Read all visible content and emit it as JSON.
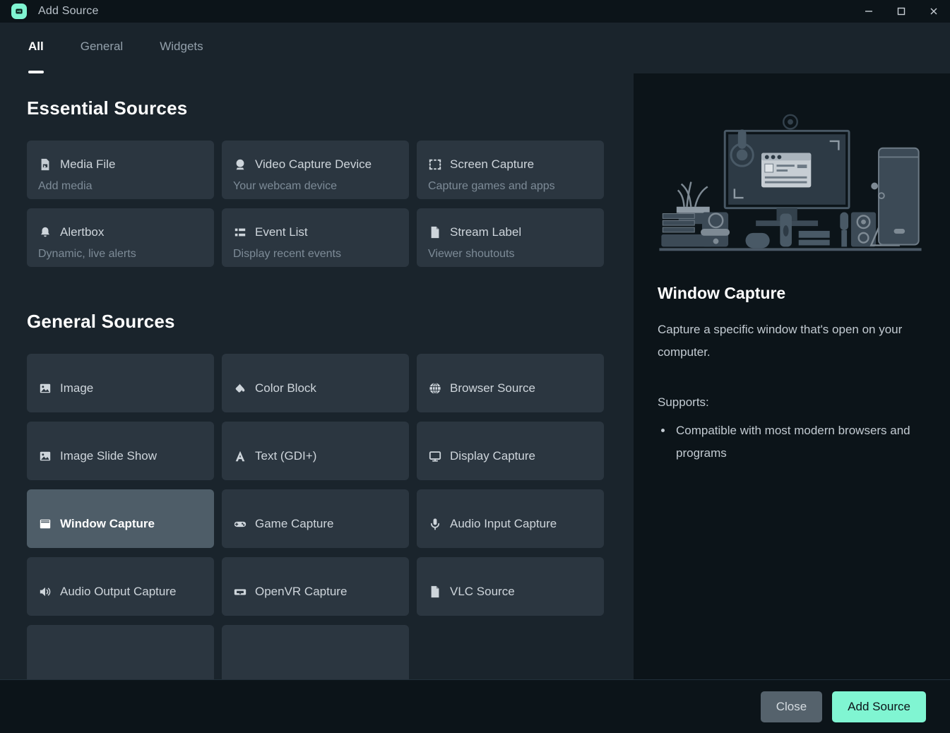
{
  "window": {
    "title": "Add Source",
    "logo_icon": "streamlabs-logo-icon",
    "minimize_label": "Minimize",
    "maximize_label": "Maximize",
    "close_label": "Close window",
    "accent_color": "#80f5d2",
    "background_color": "#1a242c",
    "panel_color": "#0c1419",
    "card_color": "#2b3640",
    "card_selected_color": "#4e5d68"
  },
  "tabs": [
    {
      "label": "All",
      "active": true
    },
    {
      "label": "General",
      "active": false
    },
    {
      "label": "Widgets",
      "active": false
    }
  ],
  "sections": [
    {
      "title": "Essential Sources",
      "items": [
        {
          "label": "Media File",
          "sub": "Add media",
          "icon": "media-file-icon",
          "selected": false
        },
        {
          "label": "Video Capture Device",
          "sub": "Your webcam device",
          "icon": "webcam-icon",
          "selected": false
        },
        {
          "label": "Screen Capture",
          "sub": "Capture games and apps",
          "icon": "screen-capture-icon",
          "selected": false
        },
        {
          "label": "Alertbox",
          "sub": "Dynamic, live alerts",
          "icon": "bell-icon",
          "selected": false
        },
        {
          "label": "Event List",
          "sub": "Display recent events",
          "icon": "list-icon",
          "selected": false
        },
        {
          "label": "Stream Label",
          "sub": "Viewer shoutouts",
          "icon": "document-icon",
          "selected": false
        }
      ]
    },
    {
      "title": "General Sources",
      "items": [
        {
          "label": "Image",
          "sub": "",
          "icon": "image-icon",
          "selected": false
        },
        {
          "label": "Color Block",
          "sub": "",
          "icon": "paint-bucket-icon",
          "selected": false
        },
        {
          "label": "Browser Source",
          "sub": "",
          "icon": "globe-icon",
          "selected": false
        },
        {
          "label": "Image Slide Show",
          "sub": "",
          "icon": "image-icon",
          "selected": false
        },
        {
          "label": "Text (GDI+)",
          "sub": "",
          "icon": "text-a-icon",
          "selected": false
        },
        {
          "label": "Display Capture",
          "sub": "",
          "icon": "monitor-icon",
          "selected": false
        },
        {
          "label": "Window Capture",
          "sub": "",
          "icon": "window-icon",
          "selected": true
        },
        {
          "label": "Game Capture",
          "sub": "",
          "icon": "gamepad-icon",
          "selected": false
        },
        {
          "label": "Audio Input Capture",
          "sub": "",
          "icon": "microphone-icon",
          "selected": false
        },
        {
          "label": "Audio Output Capture",
          "sub": "",
          "icon": "speaker-icon",
          "selected": false
        },
        {
          "label": "OpenVR Capture",
          "sub": "",
          "icon": "vr-headset-icon",
          "selected": false
        },
        {
          "label": "VLC Source",
          "sub": "",
          "icon": "document-icon",
          "selected": false
        },
        {
          "label": "",
          "sub": "",
          "icon": "",
          "selected": false
        },
        {
          "label": "",
          "sub": "",
          "icon": "",
          "selected": false
        }
      ]
    }
  ],
  "detail": {
    "illustration_name": "desk-setup-illustration",
    "title": "Window Capture",
    "description": "Capture a specific window that's open on your computer.",
    "supports_label": "Supports:",
    "supports_items": [
      "Compatible with most modern browsers and programs"
    ]
  },
  "footer": {
    "close_label": "Close",
    "add_label": "Add Source"
  }
}
